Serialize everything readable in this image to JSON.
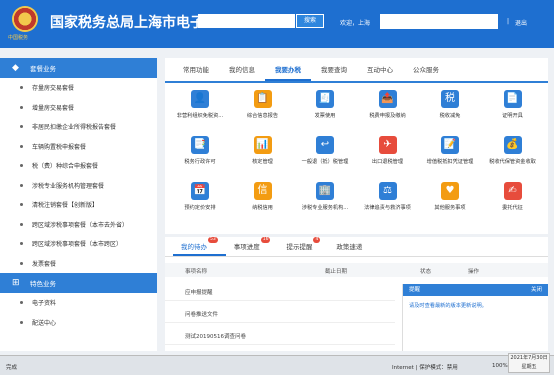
{
  "header": {
    "title": "国家税务总局上海市电子",
    "search_label": "搜索",
    "welcome": "欢迎，上海",
    "separator": "|",
    "logout": "退出",
    "logo_text": "中国税务"
  },
  "sidebar": {
    "section1": "套餐业务",
    "items": [
      "存量房交易套餐",
      "增量房交易套餐",
      "非居民扣缴企业所得税报告套餐",
      "车辆购置税申报套餐",
      "税（费）种综合申报套餐",
      "涉税专业服务机构管理套餐",
      "清税注销套餐【创新版】",
      "跨区域涉税事项套餐（本市去外省）",
      "跨区域涉税事项套餐（本市跨区）",
      "发票套餐"
    ],
    "section2": "特色业务",
    "items2": [
      "电子资料",
      "配送中心"
    ]
  },
  "main": {
    "tabs": [
      "常用功能",
      "我的信息",
      "我要办税",
      "我要查询",
      "互动中心",
      "公众服务"
    ],
    "services": [
      {
        "label": "非营利组织免税资...",
        "icon": "person-id-icon",
        "color": "#2f7fd6"
      },
      {
        "label": "综合信息报告",
        "icon": "report-icon",
        "color": "#f39c12"
      },
      {
        "label": "发票使用",
        "icon": "invoice-icon",
        "color": "#2f7fd6"
      },
      {
        "label": "税费申报及缴纳",
        "icon": "declare-icon",
        "color": "#2f7fd6"
      },
      {
        "label": "税收减免",
        "icon": "tax-reduce-icon",
        "color": "#2f7fd6"
      },
      {
        "label": "证明开具",
        "icon": "certificate-icon",
        "color": "#2f7fd6"
      },
      {
        "label": "税务行政许可",
        "icon": "admin-permit-icon",
        "color": "#2f7fd6"
      },
      {
        "label": "核定管理",
        "icon": "assess-icon",
        "color": "#f39c12"
      },
      {
        "label": "一般退（抵）税管理",
        "icon": "refund-icon",
        "color": "#2f7fd6"
      },
      {
        "label": "出口退税管理",
        "icon": "export-refund-icon",
        "color": "#e74c3c"
      },
      {
        "label": "增值税抵扣凭证管理",
        "icon": "vat-voucher-icon",
        "color": "#2f7fd6"
      },
      {
        "label": "税收代保管资金收取",
        "icon": "custody-icon",
        "color": "#2f7fd6"
      },
      {
        "label": "预约定价安排",
        "icon": "calendar-icon",
        "color": "#2f7fd6"
      },
      {
        "label": "纳税信用",
        "icon": "credit-icon",
        "color": "#f39c12"
      },
      {
        "label": "涉税专业服务机构...",
        "icon": "agency-icon",
        "color": "#2f7fd6"
      },
      {
        "label": "法律追责与救济事项",
        "icon": "gavel-icon",
        "color": "#2f7fd6"
      },
      {
        "label": "其他服务事项",
        "icon": "heart-hand-icon",
        "color": "#f39c12"
      },
      {
        "label": "委托代征",
        "icon": "entrust-icon",
        "color": "#e74c3c"
      }
    ]
  },
  "todo": {
    "tabs": [
      {
        "label": "我的待办",
        "badge": "53"
      },
      {
        "label": "事项进度",
        "badge": "16"
      },
      {
        "label": "提示提醒",
        "badge": "4"
      },
      {
        "label": "政策速递",
        "badge": ""
      }
    ],
    "columns": [
      "事项名称",
      "截止日期",
      "状态",
      "操作"
    ],
    "rows": [
      "应申报提醒",
      "问卷推送文件",
      "测试20190516调查问卷"
    ]
  },
  "notice": {
    "title": "提醒",
    "close": "关闭",
    "body": "请及时查看最新的版本更新说明。"
  },
  "statusbar": {
    "left": "完成",
    "internet": "Internet | 保护模式：禁用",
    "zoom": "100%",
    "date": "2021年7月30日",
    "weekday": "星期五"
  }
}
